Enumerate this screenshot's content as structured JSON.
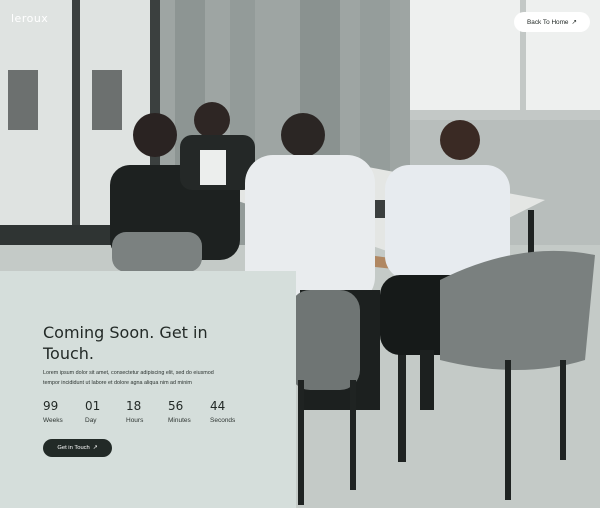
{
  "header": {
    "logo": "leroux",
    "back_button_label": "Back To Home",
    "back_button_icon": "arrow-up-right-icon"
  },
  "main": {
    "title_line1": "Coming Soon. Get in",
    "title_line2": "Touch.",
    "description_line1": "Lorem ipsum dolor sit amet, consectetur adipiscing elit, sed do eiusmod",
    "description_line2": "tempor incididunt ut labore et dolore agna aliqua nim ad minim",
    "countdown": [
      {
        "value": "99",
        "unit": "Weeks"
      },
      {
        "value": "01",
        "unit": "Day"
      },
      {
        "value": "18",
        "unit": "Hours"
      },
      {
        "value": "56",
        "unit": "Minutes"
      },
      {
        "value": "44",
        "unit": "Seconds"
      }
    ],
    "cta_label": "Get in Touch",
    "cta_icon": "arrow-up-right-icon"
  },
  "colors": {
    "panel_bg": "#d5dedb",
    "dark_button": "#222a27",
    "text_dark": "#232a27"
  }
}
